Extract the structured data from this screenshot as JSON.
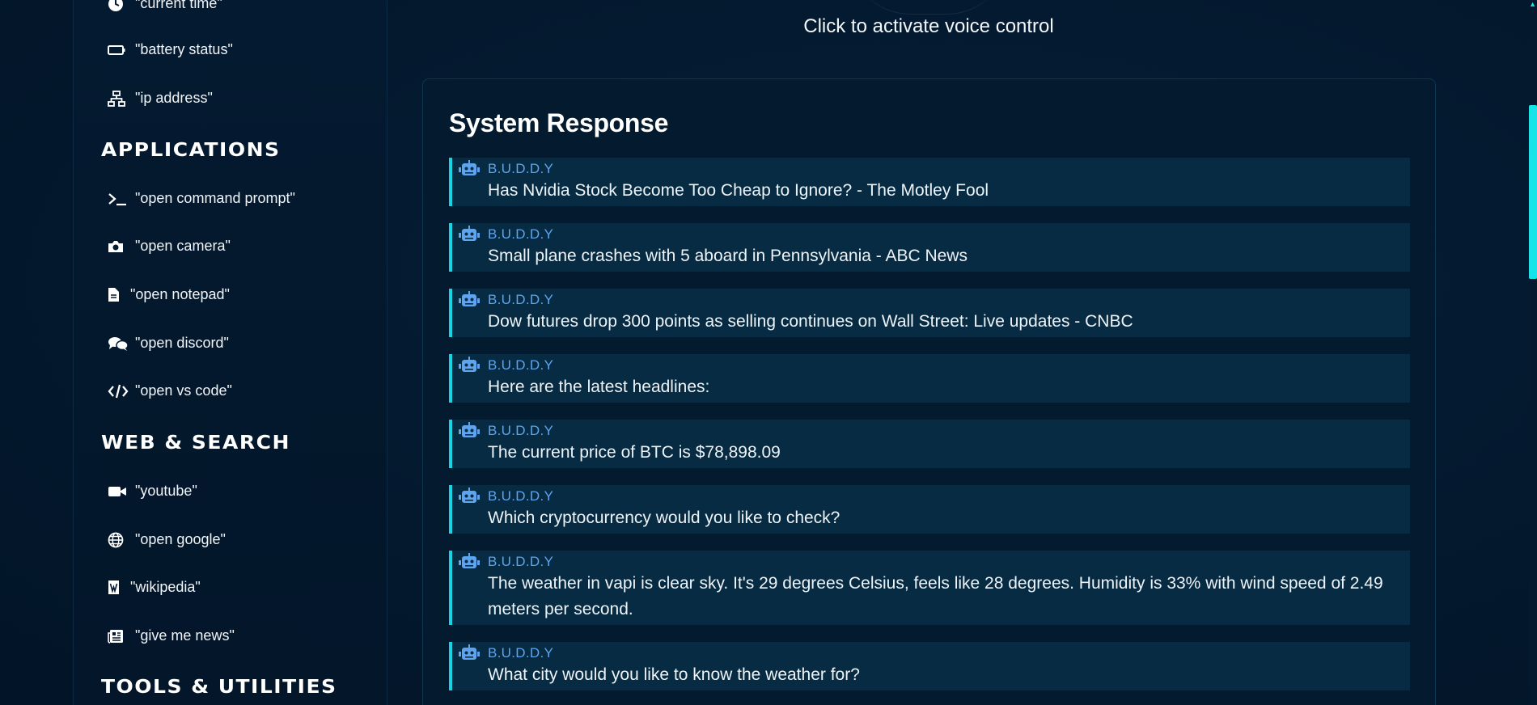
{
  "sidebar": {
    "system_commands": [
      {
        "label": "\"current time\"",
        "icon": "clock-icon"
      },
      {
        "label": "\"battery status\"",
        "icon": "battery-icon"
      },
      {
        "label": "\"ip address\"",
        "icon": "network-icon"
      }
    ],
    "applications": {
      "title": "APPLICATIONS",
      "items": [
        {
          "label": "\"open command prompt\"",
          "icon": "terminal-icon"
        },
        {
          "label": "\"open camera\"",
          "icon": "camera-icon"
        },
        {
          "label": "\"open notepad\"",
          "icon": "file-icon"
        },
        {
          "label": "\"open discord\"",
          "icon": "chat-icon"
        },
        {
          "label": "\"open vs code\"",
          "icon": "code-icon"
        }
      ]
    },
    "web_search": {
      "title": "WEB & SEARCH",
      "items": [
        {
          "label": "\"youtube\"",
          "icon": "video-icon"
        },
        {
          "label": "\"open google\"",
          "icon": "globe-icon"
        },
        {
          "label": "\"wikipedia\"",
          "icon": "wikipedia-icon"
        },
        {
          "label": "\"give me news\"",
          "icon": "newspaper-icon"
        }
      ]
    },
    "tools": {
      "title": "TOOLS & UTILITIES"
    }
  },
  "voice": {
    "hint": "Click to activate voice control"
  },
  "response_panel": {
    "title": "System Response",
    "messages": [
      {
        "sender": "B.U.D.D.Y",
        "text": "Has Nvidia Stock Become Too Cheap to Ignore? - The Motley Fool"
      },
      {
        "sender": "B.U.D.D.Y",
        "text": "Small plane crashes with 5 aboard in Pennsylvania - ABC News"
      },
      {
        "sender": "B.U.D.D.Y",
        "text": "Dow futures drop 300 points as selling continues on Wall Street: Live updates - CNBC"
      },
      {
        "sender": "B.U.D.D.Y",
        "text": "Here are the latest headlines:"
      },
      {
        "sender": "B.U.D.D.Y",
        "text": "The current price of BTC is $78,898.09"
      },
      {
        "sender": "B.U.D.D.Y",
        "text": "Which cryptocurrency would you like to check?"
      },
      {
        "sender": "B.U.D.D.Y",
        "text": "The weather in vapi is clear sky. It's 29 degrees Celsius, feels like 28 degrees. Humidity is 33% with wind speed of 2.49 meters per second."
      },
      {
        "sender": "B.U.D.D.Y",
        "text": "What city would you like to know the weather for?"
      }
    ]
  },
  "colors": {
    "accent": "#18d3e3",
    "sender": "#5ea4ee",
    "panel_bg": "#041a2f",
    "message_bg": "#062b42"
  }
}
